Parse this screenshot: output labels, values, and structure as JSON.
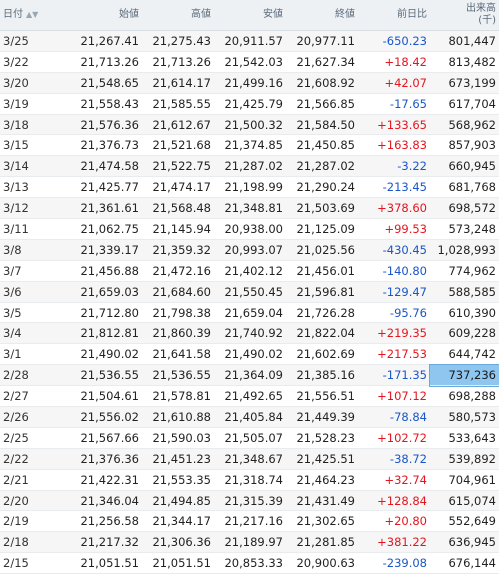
{
  "headers": {
    "date": "日付",
    "open": "始値",
    "high": "高値",
    "low": "安値",
    "close": "終値",
    "change": "前日比",
    "volume_line1": "出来高",
    "volume_line2": "(千)"
  },
  "icons": {
    "sort": "sort-arrows-icon"
  },
  "colors": {
    "up": "#e4151e",
    "down": "#1a56c9",
    "highlight": "#8ec6ef"
  },
  "highlighted_row": 16,
  "rows": [
    {
      "date": "3/25",
      "open": "21,267.41",
      "high": "21,275.43",
      "low": "20,911.57",
      "close": "20,977.11",
      "change": "-650.23",
      "volume": "801,447"
    },
    {
      "date": "3/22",
      "open": "21,713.26",
      "high": "21,713.26",
      "low": "21,542.03",
      "close": "21,627.34",
      "change": "+18.42",
      "volume": "813,482"
    },
    {
      "date": "3/20",
      "open": "21,548.65",
      "high": "21,614.17",
      "low": "21,499.16",
      "close": "21,608.92",
      "change": "+42.07",
      "volume": "673,199"
    },
    {
      "date": "3/19",
      "open": "21,558.43",
      "high": "21,585.55",
      "low": "21,425.79",
      "close": "21,566.85",
      "change": "-17.65",
      "volume": "617,704"
    },
    {
      "date": "3/18",
      "open": "21,576.36",
      "high": "21,612.67",
      "low": "21,500.32",
      "close": "21,584.50",
      "change": "+133.65",
      "volume": "568,962"
    },
    {
      "date": "3/15",
      "open": "21,376.73",
      "high": "21,521.68",
      "low": "21,374.85",
      "close": "21,450.85",
      "change": "+163.83",
      "volume": "857,903"
    },
    {
      "date": "3/14",
      "open": "21,474.58",
      "high": "21,522.75",
      "low": "21,287.02",
      "close": "21,287.02",
      "change": "-3.22",
      "volume": "660,945"
    },
    {
      "date": "3/13",
      "open": "21,425.77",
      "high": "21,474.17",
      "low": "21,198.99",
      "close": "21,290.24",
      "change": "-213.45",
      "volume": "681,768"
    },
    {
      "date": "3/12",
      "open": "21,361.61",
      "high": "21,568.48",
      "low": "21,348.81",
      "close": "21,503.69",
      "change": "+378.60",
      "volume": "698,572"
    },
    {
      "date": "3/11",
      "open": "21,062.75",
      "high": "21,145.94",
      "low": "20,938.00",
      "close": "21,125.09",
      "change": "+99.53",
      "volume": "573,248"
    },
    {
      "date": "3/8",
      "open": "21,339.17",
      "high": "21,359.32",
      "low": "20,993.07",
      "close": "21,025.56",
      "change": "-430.45",
      "volume": "1,028,993"
    },
    {
      "date": "3/7",
      "open": "21,456.88",
      "high": "21,472.16",
      "low": "21,402.12",
      "close": "21,456.01",
      "change": "-140.80",
      "volume": "774,962"
    },
    {
      "date": "3/6",
      "open": "21,659.03",
      "high": "21,684.60",
      "low": "21,550.45",
      "close": "21,596.81",
      "change": "-129.47",
      "volume": "588,585"
    },
    {
      "date": "3/5",
      "open": "21,712.80",
      "high": "21,798.38",
      "low": "21,659.04",
      "close": "21,726.28",
      "change": "-95.76",
      "volume": "610,390"
    },
    {
      "date": "3/4",
      "open": "21,812.81",
      "high": "21,860.39",
      "low": "21,740.92",
      "close": "21,822.04",
      "change": "+219.35",
      "volume": "609,228"
    },
    {
      "date": "3/1",
      "open": "21,490.02",
      "high": "21,641.58",
      "low": "21,490.02",
      "close": "21,602.69",
      "change": "+217.53",
      "volume": "644,742"
    },
    {
      "date": "2/28",
      "open": "21,536.55",
      "high": "21,536.55",
      "low": "21,364.09",
      "close": "21,385.16",
      "change": "-171.35",
      "volume": "737,236"
    },
    {
      "date": "2/27",
      "open": "21,504.61",
      "high": "21,578.81",
      "low": "21,492.65",
      "close": "21,556.51",
      "change": "+107.12",
      "volume": "698,288"
    },
    {
      "date": "2/26",
      "open": "21,556.02",
      "high": "21,610.88",
      "low": "21,405.84",
      "close": "21,449.39",
      "change": "-78.84",
      "volume": "580,573"
    },
    {
      "date": "2/25",
      "open": "21,567.66",
      "high": "21,590.03",
      "low": "21,505.07",
      "close": "21,528.23",
      "change": "+102.72",
      "volume": "533,643"
    },
    {
      "date": "2/22",
      "open": "21,376.36",
      "high": "21,451.23",
      "low": "21,348.67",
      "close": "21,425.51",
      "change": "-38.72",
      "volume": "539,892"
    },
    {
      "date": "2/21",
      "open": "21,422.31",
      "high": "21,553.35",
      "low": "21,318.74",
      "close": "21,464.23",
      "change": "+32.74",
      "volume": "704,961"
    },
    {
      "date": "2/20",
      "open": "21,346.04",
      "high": "21,494.85",
      "low": "21,315.39",
      "close": "21,431.49",
      "change": "+128.84",
      "volume": "615,074"
    },
    {
      "date": "2/19",
      "open": "21,256.58",
      "high": "21,344.17",
      "low": "21,217.16",
      "close": "21,302.65",
      "change": "+20.80",
      "volume": "552,649"
    },
    {
      "date": "2/18",
      "open": "21,217.32",
      "high": "21,306.36",
      "low": "21,189.97",
      "close": "21,281.85",
      "change": "+381.22",
      "volume": "636,945"
    },
    {
      "date": "2/15",
      "open": "21,051.51",
      "high": "21,051.51",
      "low": "20,853.33",
      "close": "20,900.63",
      "change": "-239.08",
      "volume": "676,144"
    }
  ]
}
